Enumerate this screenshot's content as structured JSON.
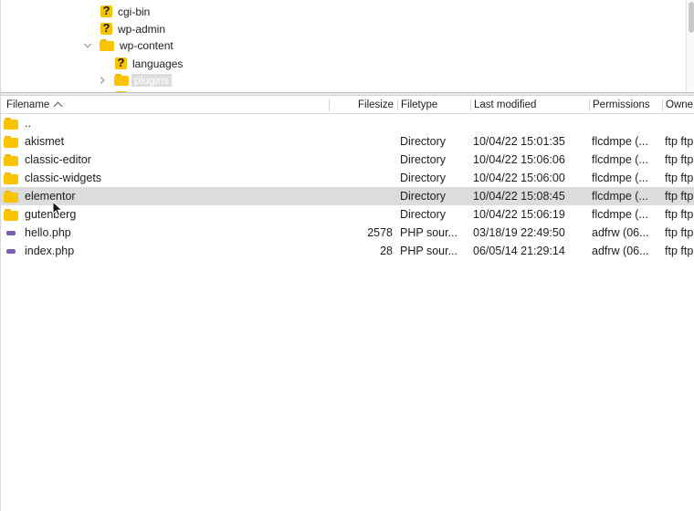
{
  "tree": {
    "items": [
      {
        "label": "cgi-bin",
        "icon": "question-folder-icon",
        "disclosure": ""
      },
      {
        "label": "wp-admin",
        "icon": "question-folder-icon",
        "disclosure": ""
      },
      {
        "label": "wp-content",
        "icon": "folder-icon",
        "disclosure": "chevron-down-icon"
      },
      {
        "label": "languages",
        "icon": "question-folder-icon",
        "disclosure": ""
      },
      {
        "label": "plugins",
        "icon": "folder-icon",
        "disclosure": "chevron-right-icon",
        "selected": true
      }
    ]
  },
  "list": {
    "columns": {
      "filename": "Filename",
      "filesize": "Filesize",
      "filetype": "Filetype",
      "last_modified": "Last modified",
      "permissions": "Permissions",
      "owner": "Owne"
    },
    "rows": [
      {
        "name": "..",
        "size": "",
        "type": "",
        "modified": "",
        "perm": "",
        "owner": "",
        "icon": "folder-icon"
      },
      {
        "name": "akismet",
        "size": "",
        "type": "Directory",
        "modified": "10/04/22 15:01:35",
        "perm": "flcdmpe (...",
        "owner": "ftp ftp",
        "icon": "folder-icon"
      },
      {
        "name": "classic-editor",
        "size": "",
        "type": "Directory",
        "modified": "10/04/22 15:06:06",
        "perm": "flcdmpe (...",
        "owner": "ftp ftp",
        "icon": "folder-icon"
      },
      {
        "name": "classic-widgets",
        "size": "",
        "type": "Directory",
        "modified": "10/04/22 15:06:00",
        "perm": "flcdmpe (...",
        "owner": "ftp ftp",
        "icon": "folder-icon"
      },
      {
        "name": "elementor",
        "size": "",
        "type": "Directory",
        "modified": "10/04/22 15:08:45",
        "perm": "flcdmpe (...",
        "owner": "ftp ftp",
        "icon": "folder-icon",
        "selected": true
      },
      {
        "name": "gutenberg",
        "size": "",
        "type": "Directory",
        "modified": "10/04/22 15:06:19",
        "perm": "flcdmpe (...",
        "owner": "ftp ftp",
        "icon": "folder-icon"
      },
      {
        "name": "hello.php",
        "size": "2578",
        "type": "PHP sour...",
        "modified": "03/18/19 22:49:50",
        "perm": "adfrw (06...",
        "owner": "ftp ftp",
        "icon": "php-file-icon"
      },
      {
        "name": "index.php",
        "size": "28",
        "type": "PHP sour...",
        "modified": "06/05/14 21:29:14",
        "perm": "adfrw (06...",
        "owner": "ftp ftp",
        "icon": "php-file-icon"
      }
    ]
  },
  "colors": {
    "folder": "#f9c300",
    "selection": "#dcdcdc",
    "php_badge": "#7a5fb5"
  }
}
